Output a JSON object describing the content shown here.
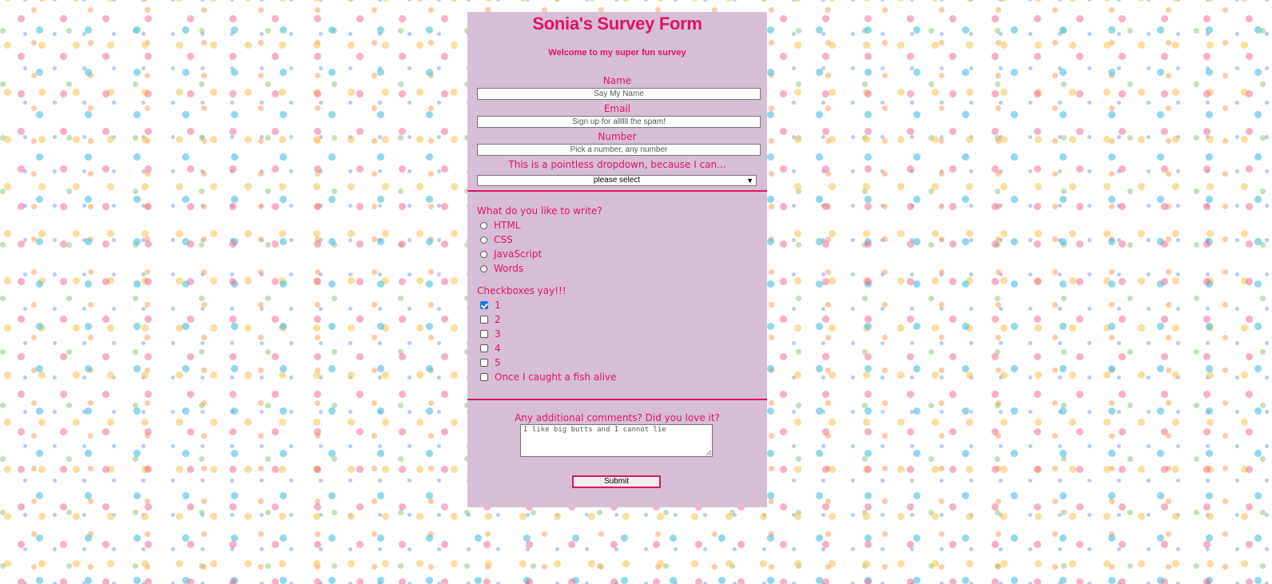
{
  "form": {
    "title": "Sonia's Survey Form",
    "subtitle": "Welcome to my super fun survey",
    "name": {
      "label": "Name",
      "placeholder": "Say My Name"
    },
    "email": {
      "label": "Email",
      "placeholder": "Sign up for allllll the spam!"
    },
    "number": {
      "label": "Number",
      "placeholder": "Pick a number, any number"
    },
    "dropdown": {
      "label": "This is a pointless dropdown, because I can...",
      "selected": "please select"
    },
    "radio_group": {
      "heading": "What do you like to write?",
      "options": [
        "HTML",
        "CSS",
        "JavaScript",
        "Words"
      ],
      "selected": null
    },
    "checkbox_group": {
      "heading": "Checkboxes yay!!!",
      "options": [
        {
          "label": "1",
          "checked": true
        },
        {
          "label": "2",
          "checked": false
        },
        {
          "label": "3",
          "checked": false
        },
        {
          "label": "4",
          "checked": false
        },
        {
          "label": "5",
          "checked": false
        },
        {
          "label": "Once I caught a fish alive",
          "checked": false
        }
      ]
    },
    "comments": {
      "label": "Any additional comments? Did you love it?",
      "value": "I like big butts and I cannot lie"
    },
    "submit_label": "Submit"
  },
  "colors": {
    "accent": "#e0135e",
    "panel_background": "#d6bed7",
    "checkbox_checked": "#1a73e8"
  }
}
